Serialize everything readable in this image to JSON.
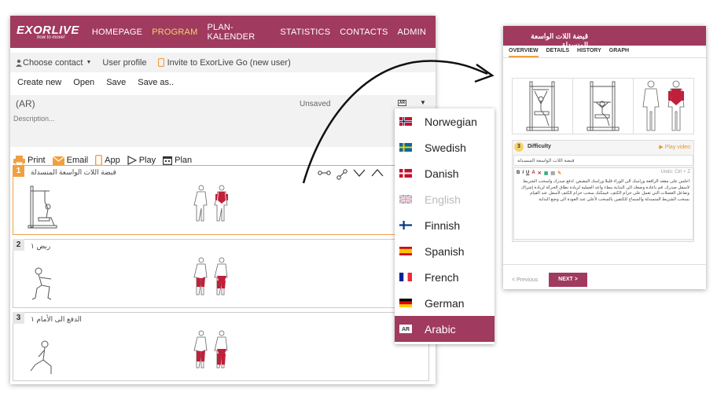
{
  "nav": {
    "logo_main": "EXORLIVE",
    "logo_sub": "how to move!",
    "items": [
      {
        "label": "HOMEPAGE",
        "active": false
      },
      {
        "label": "PROGRAM",
        "active": true
      },
      {
        "label": "PLAN-KALENDER",
        "active": false
      },
      {
        "label": "STATISTICS",
        "active": false
      },
      {
        "label": "CONTACTS",
        "active": false
      },
      {
        "label": "ADMIN",
        "active": false
      }
    ]
  },
  "toolbar1": {
    "choose_contact": "Choose contact",
    "user_profile": "User profile",
    "invite": "Invite to ExorLive Go (new user)"
  },
  "toolbar2": {
    "create_new": "Create new",
    "open": "Open",
    "save": "Save",
    "save_as": "Save as.."
  },
  "plan": {
    "name": "(AR)",
    "status": "Unsaved",
    "lang_badge": "AR",
    "description_placeholder": "Description..."
  },
  "actions": {
    "print": "Print",
    "email": "Email",
    "app": "App",
    "play": "Play",
    "plan": "Plan"
  },
  "exercises": [
    {
      "num": "1",
      "title": "قبضة اللات الواسعة المنسدلة"
    },
    {
      "num": "2",
      "title": "ربض ١"
    },
    {
      "num": "3",
      "title": "الدفع الى الأمام ١"
    }
  ],
  "languages": [
    {
      "label": "Norwegian",
      "state": "normal"
    },
    {
      "label": "Swedish",
      "state": "normal"
    },
    {
      "label": "Danish",
      "state": "normal"
    },
    {
      "label": "English",
      "state": "disabled"
    },
    {
      "label": "Finnish",
      "state": "normal"
    },
    {
      "label": "Spanish",
      "state": "normal"
    },
    {
      "label": "French",
      "state": "normal"
    },
    {
      "label": "German",
      "state": "normal"
    },
    {
      "label": "Arabic",
      "state": "active"
    }
  ],
  "mobile": {
    "header_title": "قبضة اللات الواسعة المنسدلة",
    "tabs": [
      "OVERVIEW",
      "DETAILS",
      "HISTORY",
      "GRAPH"
    ],
    "difficulty_num": "3",
    "difficulty_label": "Difficulty",
    "play_video": "▶ Play video",
    "title_input": "قبضة اللات الواسعة المنسدلة",
    "undo": "Undo: Ctrl + Z",
    "body_text": "اجلس على مقعد الرافعة وراسك الى الوراء قليلا وراسك المقبض. ادفع صدرك واسحب الشريط لاسفل صدرك. قم باعادة وضعك الى البداية ببطء واعد العملية لزيادة نطاق الحركة لزيادة إشراك وتفاعل العضلات التي تعمل على حزام الكتف. فيمكنك سحب حزام الكتف لأسفل عند القيام بسحب الشريط المنسدلة والسماح للكتفين بالسحب لأعلى عند العودة الى وضع البداية",
    "prev": "< Previous",
    "next": "NEXT >"
  },
  "colors": {
    "brand": "#a03a5e",
    "accent": "#f5d36b",
    "selected": "#f0a040",
    "muscle": "#c0203a"
  }
}
